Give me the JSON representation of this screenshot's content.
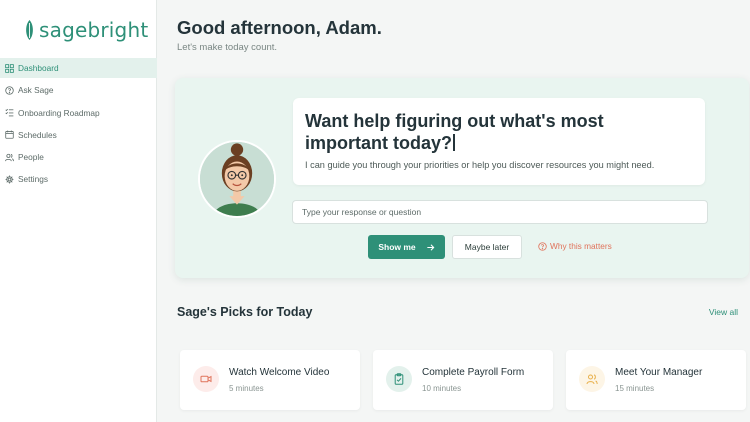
{
  "brand": {
    "name": "sagebright",
    "accent": "#2e9078"
  },
  "sidebar": {
    "items": [
      {
        "label": "Dashboard",
        "icon": "grid-icon",
        "active": true
      },
      {
        "label": "Ask Sage",
        "icon": "help-circle-icon",
        "active": false
      },
      {
        "label": "Onboarding Roadmap",
        "icon": "list-check-icon",
        "active": false
      },
      {
        "label": "Schedules",
        "icon": "calendar-icon",
        "active": false
      },
      {
        "label": "People",
        "icon": "users-icon",
        "active": false
      },
      {
        "label": "Settings",
        "icon": "gear-icon",
        "active": false
      }
    ]
  },
  "header": {
    "greeting": "Good afternoon, Adam.",
    "subtitle": "Let's make today count."
  },
  "assistant": {
    "question": "Want help figuring out what's most important today?",
    "description": "I can guide you through your priorities or help you discover resources you might need.",
    "input_placeholder": "Type your response or question",
    "primary_button": "Show me",
    "secondary_button": "Maybe later",
    "why_link": "Why this matters"
  },
  "picks": {
    "title": "Sage's Picks for Today",
    "view_all": "View all",
    "items": [
      {
        "title": "Watch Welcome Video",
        "meta": "5 minutes",
        "icon": "video-icon",
        "color": "#e0735b",
        "bg": "#fdecea"
      },
      {
        "title": "Complete Payroll Form",
        "meta": "10 minutes",
        "icon": "clipboard-check-icon",
        "color": "#2e9078",
        "bg": "#e3f1ec"
      },
      {
        "title": "Meet Your Manager",
        "meta": "15 minutes",
        "icon": "users-icon",
        "color": "#e8b04a",
        "bg": "#fdf5e6"
      }
    ]
  }
}
